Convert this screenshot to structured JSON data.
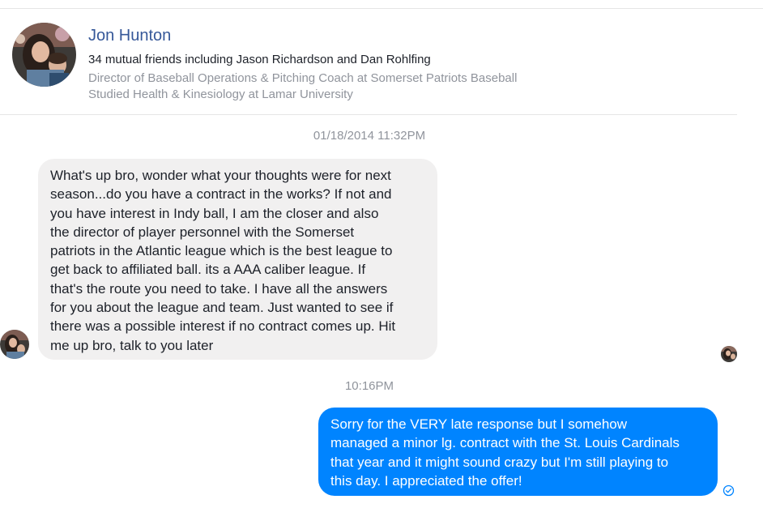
{
  "profile": {
    "name": "Jon Hunton",
    "mutual_friends": "34 mutual friends including Jason Richardson and Dan Rohlfing",
    "work": "Director of Baseball Operations & Pitching Coach at Somerset Patriots Baseball",
    "education": "Studied Health & Kinesiology at Lamar University",
    "avatar_icon": "profile-photo"
  },
  "conversation": {
    "messages": [
      {
        "timestamp": "01/18/2014 11:32PM",
        "direction": "incoming",
        "text": "What's up bro, wonder what your thoughts were for next\nseason...do you have a contract in the works? If not and\nyou have interest in Indy ball, I am the closer and also\nthe director of player personnel with the Somerset\npatriots in the Atlantic league which is the best league to\nget back to affiliated ball. its a AAA caliber league. If\nthat's the route you need to take. I have all the answers\nfor you about the league and team. Just wanted to see if\nthere was a possible interest if no contract comes up. Hit\nme up bro, talk to you later"
      },
      {
        "timestamp": "10:16PM",
        "direction": "outgoing",
        "text": "Sorry for the VERY late response but I somehow\nmanaged a minor lg. contract with the St. Louis Cardinals\nthat year and it might sound crazy but I'm still playing to\nthis day.  I appreciated the offer!",
        "status_icon": "sent-check-icon"
      }
    ]
  },
  "colors": {
    "name_link": "#365899",
    "incoming_bubble": "#f1f0f0",
    "outgoing_bubble": "#0084ff",
    "meta_text": "#90949c"
  }
}
